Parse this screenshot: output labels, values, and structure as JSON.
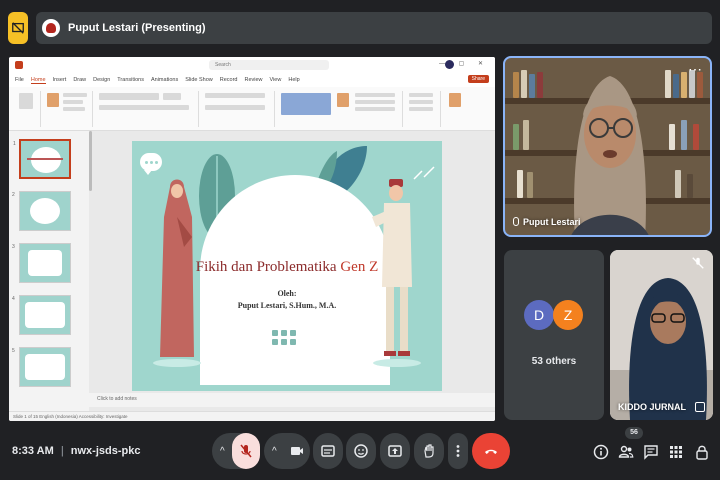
{
  "header": {
    "presenting_label": "Puput Lestari (Presenting)"
  },
  "ppt": {
    "tabs": [
      "File",
      "Home",
      "Insert",
      "Draw",
      "Design",
      "Transitions",
      "Animations",
      "Slide Show",
      "Record",
      "Review",
      "View",
      "Help"
    ],
    "active_tab": "Home",
    "share_label": "Share",
    "search_placeholder": "Search",
    "notes_placeholder": "Click to add notes",
    "status_text": "Slide 1 of 15   English (Indonesia)   Accessibility: Investigate",
    "slide": {
      "title_main": "Fikih dan Problematika ",
      "title_accent": "Gen Z",
      "by_label": "Oleh:",
      "author": "Puput Lestari, S.Hum., M.A."
    },
    "slide_numbers": [
      "1",
      "2",
      "3",
      "4",
      "5"
    ]
  },
  "participants": {
    "main_speaker": "Puput Lestari",
    "others_initials": [
      "D",
      "Z"
    ],
    "others_colors": [
      "#5c6bc0",
      "#f4811e"
    ],
    "others_label": "53 others",
    "kiddo_name": "KIDDO JURNAL"
  },
  "footer": {
    "time": "8:33 AM",
    "meeting_code": "nwx-jsds-pkc",
    "participant_count": "56"
  },
  "icons": {
    "present": "present-icon",
    "mic_off": "mic-off-icon",
    "camera": "camera-icon",
    "captions": "captions-icon",
    "emoji": "emoji-icon",
    "present_screen": "present-screen-icon",
    "hand": "raise-hand-icon",
    "more": "more-options-icon",
    "end_call": "end-call-icon",
    "info": "info-icon",
    "people": "people-icon",
    "chat": "chat-icon",
    "activities": "activities-icon",
    "lock": "host-controls-icon"
  },
  "colors": {
    "accent": "#8ab4f8",
    "end_call": "#ea4335",
    "present_chip": "#f6c026",
    "ppt_brand": "#c43e1c"
  }
}
